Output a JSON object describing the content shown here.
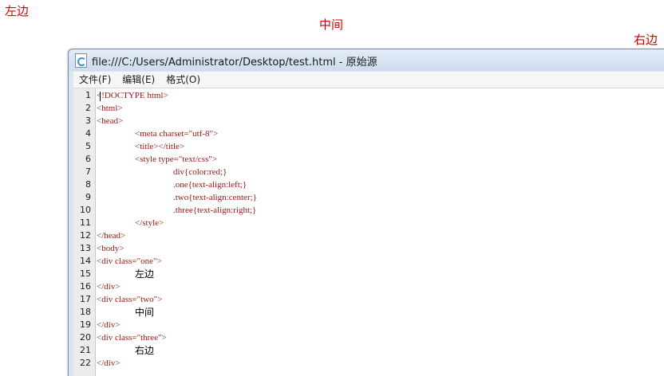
{
  "page_texts": {
    "left": "左边",
    "center": "中间",
    "right": "右边"
  },
  "colors": {
    "page_text": "#d40000",
    "code_markup": "#8b1a1a",
    "window_chrome": "#dbe6f3"
  },
  "window": {
    "title": "file:///C:/Users/Administrator/Desktop/test.html - 原始源",
    "icon": "page-icon"
  },
  "menu": [
    {
      "label": "文件(F)"
    },
    {
      "label": "编辑(E)"
    },
    {
      "label": "格式(O)"
    }
  ],
  "source_lines": [
    {
      "num": "1",
      "text": "<!DOCTYPE html>",
      "indent": 0,
      "plain": false
    },
    {
      "num": "2",
      "text": "<html>",
      "indent": 0,
      "plain": false
    },
    {
      "num": "3",
      "text": "<head>",
      "indent": 0,
      "plain": false
    },
    {
      "num": "4",
      "text": "<meta charset=\"utf-8\">",
      "indent": 1,
      "plain": false
    },
    {
      "num": "5",
      "text": "<title></title>",
      "indent": 1,
      "plain": false
    },
    {
      "num": "6",
      "text": "<style type=\"text/css\">",
      "indent": 1,
      "plain": false
    },
    {
      "num": "7",
      "text": "div{color:red;}",
      "indent": 2,
      "plain": false
    },
    {
      "num": "8",
      "text": ".one{text-align:left;}",
      "indent": 2,
      "plain": false
    },
    {
      "num": "9",
      "text": ".two{text-align:center;}",
      "indent": 2,
      "plain": false
    },
    {
      "num": "10",
      "text": ".three{text-align:right;}",
      "indent": 2,
      "plain": false
    },
    {
      "num": "11",
      "text": "</style>",
      "indent": 1,
      "plain": false
    },
    {
      "num": "12",
      "text": "</head>",
      "indent": 0,
      "plain": false
    },
    {
      "num": "13",
      "text": "<body>",
      "indent": 0,
      "plain": false
    },
    {
      "num": "14",
      "text": "<div class=\"one\">",
      "indent": 0,
      "plain": false
    },
    {
      "num": "15",
      "text": "左边",
      "indent": 1,
      "plain": true
    },
    {
      "num": "16",
      "text": "</div>",
      "indent": 0,
      "plain": false
    },
    {
      "num": "17",
      "text": "<div class=\"two\">",
      "indent": 0,
      "plain": false
    },
    {
      "num": "18",
      "text": "中间",
      "indent": 1,
      "plain": true
    },
    {
      "num": "19",
      "text": "</div>",
      "indent": 0,
      "plain": false
    },
    {
      "num": "20",
      "text": "<div class=\"three\">",
      "indent": 0,
      "plain": false
    },
    {
      "num": "21",
      "text": "右边",
      "indent": 1,
      "plain": true
    },
    {
      "num": "22",
      "text": "</div>",
      "indent": 0,
      "plain": false
    }
  ]
}
